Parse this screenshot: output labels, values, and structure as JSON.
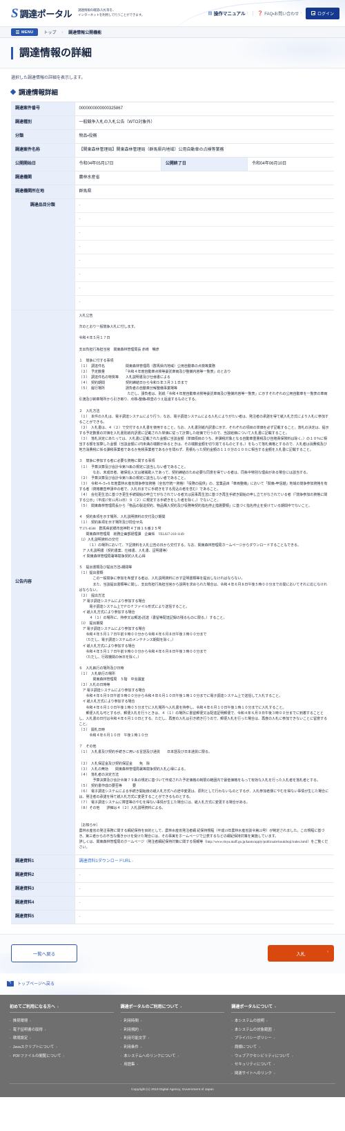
{
  "header": {
    "logo_mark": "S",
    "logo_text": "調達ポータル",
    "tagline_line1": "調達情報の確認・入札等を、",
    "tagline_line2": "インターネットを利用して行うことができます。",
    "manual_label": "操作マニュアル",
    "manual_icon": "book-icon",
    "faq_label": "FAQ・お問い合わせ",
    "faq_icon": "question-icon",
    "login_label": "ログイン",
    "login_icon": "login-icon",
    "separator": "|",
    "chevron": "›"
  },
  "breadcrumb": {
    "menu_label": "MENU",
    "items": [
      "トップ",
      "調達情報公開機能"
    ],
    "arrow": "›"
  },
  "page": {
    "title": "調達情報の詳細",
    "description": "選択した調達情報の詳細を表示します。",
    "section_title": "調達情報詳細"
  },
  "detail": {
    "rows": [
      {
        "label": "調達案件番号",
        "value": "0000000000000325867"
      },
      {
        "label": "調達種別",
        "value": "一般競争入札の入札公告（WTO対象外）"
      },
      {
        "label": "分類",
        "value": "物品・役務"
      },
      {
        "label": "調達案件名称",
        "value": "【関東森林管理局】関東森林管理局（群馬県内地域）公用自動車の点検等業務"
      }
    ],
    "publish_row": {
      "start_label": "公開開始日",
      "start_value": "令和04年05月17日",
      "end_label": "公開終了日",
      "end_value": "令和04年06月10日"
    },
    "org_row": {
      "label": "調達機関",
      "value": "農林水産省"
    },
    "location_row": {
      "label": "調達機関所在地",
      "value": "群馬県"
    },
    "category": {
      "label": "調達品目分類",
      "values": [
        "-",
        "-",
        "-",
        "-",
        "-",
        "-",
        "-",
        "-"
      ]
    },
    "announcement": {
      "label": "公告内容",
      "text": "入札公告\n\n次のとおり一般競争入札に付します。\n\n令和４年５月１７日\n\n支出負担行為担当官　関東森林管理局長 赤﨑　暢彦\n\n１　競争に付する事項\n（１）　調達件名　　　　　　関東森林管理局（群馬県内地域）公用自動車の点検等業務\n（２）　予定数量　　　　　　「令和４年度自動車点検等委託車両及び整備内容等一覧表」のとおり\n（３）　調達件名の特質等　　入札説明書及び仕様書による\n（４）　契約期間　　　　　　契約締結日から令和５年３月３１日まで\n（５）　履行場所　　　　　　請負者の自動車分解整備事業場等\n　　　　　　　　　　　　　　ただし、請負者は、別紙「令和４年度自動車点検等委託車両及び整備内容等一覧表」に示すそれぞれの公用自動車を一覧表の車両引渡及び納車場所から引き取り、点検・整備・検査のうえ返還するものとする。\n\n２　入札方法\n（１）　本件の入札は、電子調達システムにより行う。なお、電子調達システムによる入札によりがたい者は、発注者の承諾を得て紙入札方式により入札に参加することができる。\n（２）　入札書は、４（２）で交付する入札書を使用すること。なお、入札書別紙内訳書に示す、それぞれの項目の単価を必ず記載すること。落札の決定は、提示する予定数量の対価を入札書別紙内訳書に記載された単価に従って計算した総価で行うので、当該総価について入札書に記載すること。\n（３）　落札決定にあたっては、入札書に記載された金額に当該金額（単価項目のうち、非課税対象となる自動車重量税及び自賠責保険料は除く。）の１０％に相当する額を加算した金額（当該金額に1円未満の端数があるときは、その端数金額を切り捨てるものとする。）をもって落札価格とするので、入札者は消費税及び地方消費税に係る課税事業者であるか免税事業者であるかを問わず、見積もった契約金額の１１０分の１００に相当する金額を入札書に記載すること。\n\n３　競争に参加する者に必要な資格に関する事項\n（１）　予算決算及び会計令第70条の規定に該当しない者であること。\n　　　　なお、未成年者、被保佐人又は被補助人であって、契約締結のため必要な同意を得ている者は、同条中特別な理由がある場合には該当する。\n（２）　予算決算及び会計令第71条の規定に該当しない者であること。\n（３）　令和４・５・６年度農林水産省競争参加資格（全省庁統一資格）「役務の提供」の、営業品目「車両整備」において「関東・甲信越」地域の競争参加資格を有する者（資格審査申請中の者で、入札日までに手続きをする見込の者を含む）であること。\n（４）　会社更生法に基づき更生手続開始の申立てがなされている者又は民事再生法に基づき再生手続き開始の申し立てがなされている者（「競争参加の資格に関する公示」（平成27年12月24日）９（２）に規定する手続きをした者を除く。）でないこと。\n（５）　関東森林管理局長から「物品の製造契約、物品購入契約及び役務等契約指名停止措置要領」に基づく指名停止を受けている期間中でないこと。\n\n４　契約条項を示す場所、入札説明資料の交付及び期間\n（１）　契約条項を示す場所及び問合せ先\n〒371-8508　群馬県前橋市岩神町４丁目１６番２５号\n　　関東森林管理局　総務企画部経理課　企画係　TEL027-210-1149\n（2）入札説明資料の交付\n　　　（１）の場所において、下記資料を入札公告の日から交付する。なお、関東森林管理局ホームページからダウンロードすることもできる。\n　ア 入札説明書（契約書案、仕様書、入札書、証明書等）\n　イ 関東森林管理局署等競争契約入札心得\n\n５　提出書類及び提出方法・期間等\n（１）提出書類\n　　　　この一般競争に参加を希望する者は、入札説明資料に示す証明書類等を提出しなければならない。\n　　　　また、当該提出書類等に関し、支出負担行為担当官から説明を求められた場合は、令和４年６月８日午後５時００分までの間においてそれに応じなければならない。\n（２）　提出方法\n　ア 電子調達システムにより参加する場合\n　　　電子調達システム上でＰＤＦファイル形式により送信すること。\n　イ 紙入札方式により参加する場合\n　　　４（１）の場所に、持参又は郵送・託送（書留等配達記録の残るものに限る。）すること。\n（3）　提出期間\n　ア 電子調達システムにより参加する場合\n　　令和４年５月１７日午前９時００分から令和４年６月８日午後３時００分まで\n　　（ただし、電子調達システムのメンテナンス期間を除く。）\n　イ 紙入札方式により参加する場合\n　　令和４年５月１７日午前９時００分から令和４年６月８日午後３時００分まで\n　　（ただし、行政機関の休日を除く。）\n\n６　入札執行の場所及び日時\n（１）　入札執行の場所\n　　　　関東森林管理局　５階　中会議室\n（２）入札の日時等\n　ア 電子調達システムにより参加する場合\n　　令和４年６月９日午前９時００分から令和４年６月１０日午後１時１０分までに電子調達システム上で送信して入札すること。\n　イ 紙入札方式により参加する場合\n　　令和４年６月１０日午後１時０５分までに入札場所へ入札書を持参し、令和４年６月１０日午後１時１０分までに入札すること。\n　　郵便入札も可とするが、郵便入札を行うときは、４（１）の場所に書留郵便又は配達証明郵便で、令和４年６月９日午後３時００分までに到着することとし、入札書の日付は令和４年６月１０日とする。ただし、再度の入札は引き続き行うので、郵便入札を行った場合は、再度の入札に参加できないことに留意すること。\n（３）　開札日時\n　　　令和４年６月１０日　午後１時１０分\n\n７　その他\n（１）　入札書及び契約手続きに用いる言語及び通貨　　日本語及び日本通貨に限る。\n\n（２）　入札保証金及び契約保証金　　免　除\n（３）　入札の無効　　関東森林管理局署等競争契約入札心得による。\n（４）　落札者の決定方法\n　　　　予算決算及び会計令第７９条の規定に基づいて作成された予定価格の制限の範囲内で最低価格をもって有効な入札を行った入札者を落札者とする。\n（５）　契約書作成の要否等　　　要\n（６）　電子調達システムによる手続き開始後の紙入札方式への途中変更は、原則として行わないものとするが、入札参加者側にやむを得ない事情が生じた場合には、発注者の承諾を得て紙入札方式に変更することができるものとする。\n（７）　電子調達システムに障害等のやむを得ない事情が生じた場合には、紙入札方式に変更する場合がある。\n（８）その他　　詳細は４（２）入札説明資料による。\n\n\n［お知らせ］\n農林水産省の発注事務に関する綱紀保持を目的として、農林水産省発注者綱 紀保持規程（平成19年農林水産省訓令第22号）が制定されました。この規程に基づき、第三者からの不当な働きかけを受けた場合には、その事実をホームページで公表するなどの綱紀保持対策を実施しています。\n詳しくは、関東森林管理局のホームページ（発注者綱紀保持対策に関する情報等（http://www.rinya.maff.go.jp/kanto/apply/publicsale/koukihoji/index.html）をご覧ください。"
    },
    "documents": [
      {
        "label": "調達資料1",
        "value": "調達資料1ダウンロードURL",
        "is_link": true
      },
      {
        "label": "調達資料2",
        "value": "-",
        "is_link": false
      },
      {
        "label": "調達資料3",
        "value": "-",
        "is_link": false
      },
      {
        "label": "調達資料4",
        "value": "-",
        "is_link": false
      },
      {
        "label": "調達資料5",
        "value": "-",
        "is_link": false
      }
    ]
  },
  "actions": {
    "back_label": "一覧へ戻る",
    "bid_label": "入札",
    "bid_chevron": "›",
    "back_to_top_label": "トップページへ戻る"
  },
  "footer": {
    "columns": [
      {
        "heading": "初めてご利用になる方へ",
        "links": [
          "推奨環境",
          "電子証明書の取得",
          "環境設定",
          "Javaスクリプトについて",
          "PDFファイルの閲覧について"
        ]
      },
      {
        "heading": "調達ポータルのご利用について",
        "links": [
          "利用時間",
          "利用規約",
          "利用可能文字",
          "利用条件",
          "本システムへのリンクについて",
          "用語集"
        ]
      },
      {
        "heading": "調達ポータルについて",
        "links": [
          "本システムの説明",
          "本システムの対象範囲",
          "プライバシーポリシー",
          "商標について",
          "ウェブアクセシビリティについて",
          "セキュリティについて",
          "関連サイトへのリンク"
        ]
      }
    ],
    "chevron": "›",
    "dot": "-",
    "copyright": "Copyright (c) 2018 Digital Agency, Government of Japan"
  },
  "colors": {
    "brand_blue": "#2b56b0",
    "dark_navy": "#15398f",
    "bid_orange": "#d8480f",
    "th_bg": "#e8eefa",
    "footer_bg": "#6f6f6f"
  }
}
